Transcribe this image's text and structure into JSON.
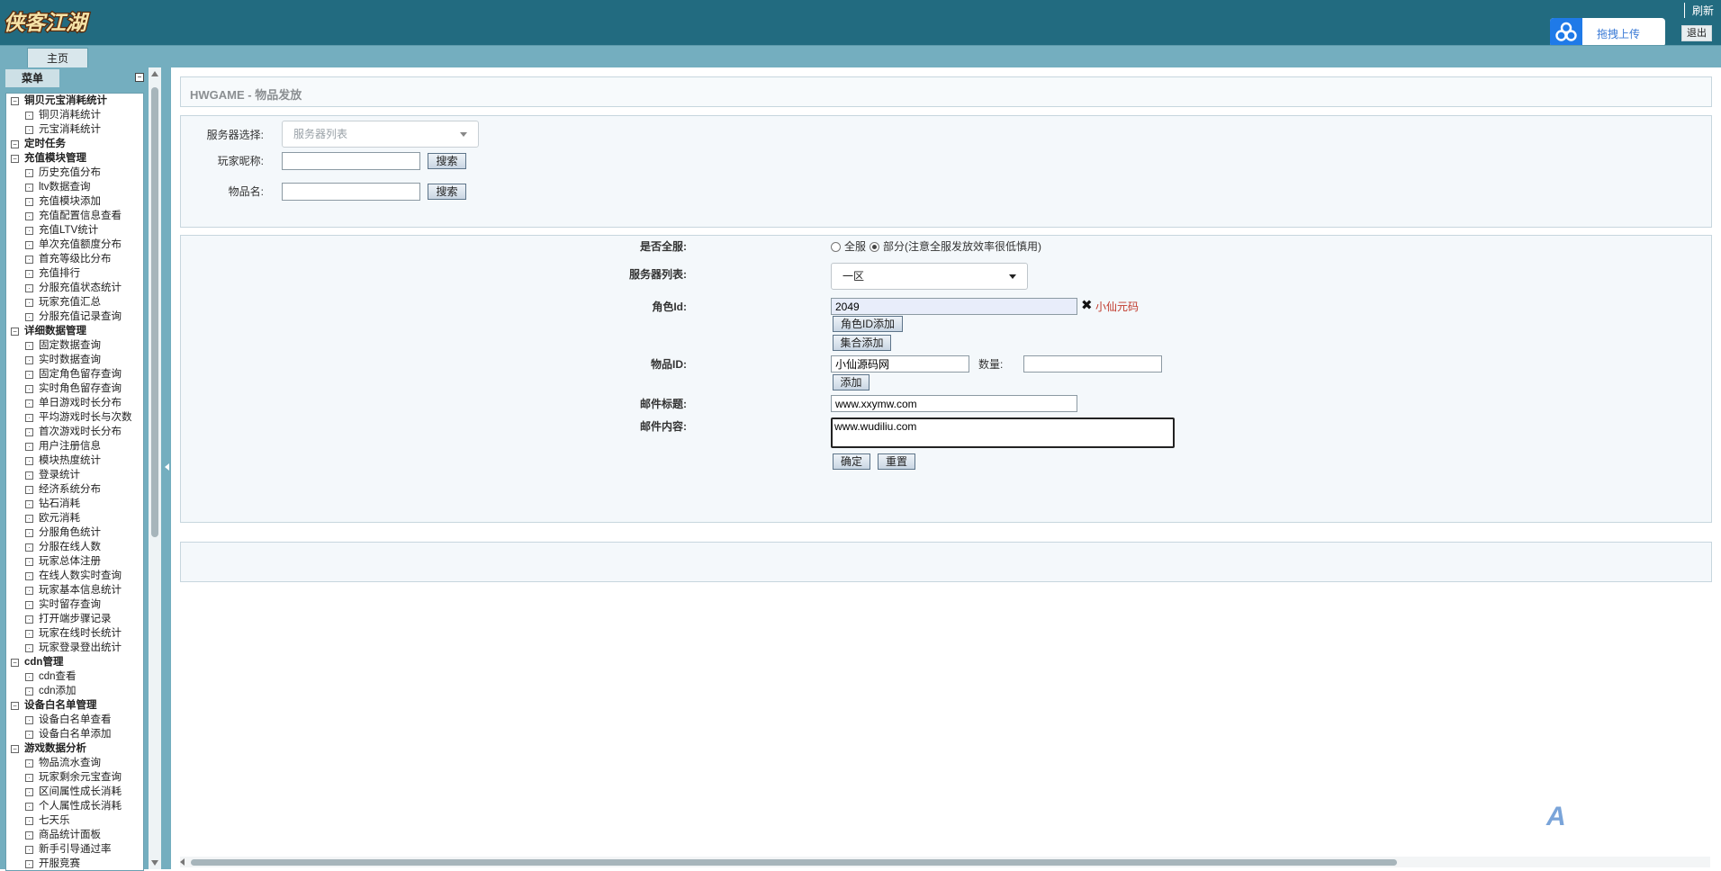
{
  "header": {
    "logo_text": "侠客江湖",
    "refresh_label": "刷新",
    "upload_label": "拖拽上传",
    "logout_label": "退出"
  },
  "tabs": {
    "home_label": "主页"
  },
  "sidebar": {
    "menu_label": "菜单",
    "groups": [
      {
        "label": "铜贝元宝消耗统计",
        "items": [
          "铜贝消耗统计",
          "元宝消耗统计"
        ]
      },
      {
        "label": "定时任务",
        "items": []
      },
      {
        "label": "充值模块管理",
        "items": [
          "历史充值分布",
          "ltv数据查询",
          "充值模块添加",
          "充值配置信息查看",
          "充值LTV统计",
          "单次充值额度分布",
          "首充等级比分布",
          "充值排行",
          "分服充值状态统计",
          "玩家充值汇总",
          "分服充值记录查询"
        ]
      },
      {
        "label": "详细数据管理",
        "items": [
          "固定数据查询",
          "实时数据查询",
          "固定角色留存查询",
          "实时角色留存查询",
          "单日游戏时长分布",
          "平均游戏时长与次数",
          "首次游戏时长分布",
          "用户注册信息",
          "模块热度统计",
          "登录统计",
          "经济系统分布",
          "钻石消耗",
          "欧元消耗",
          "分服角色统计",
          "分服在线人数",
          "玩家总体注册",
          "在线人数实时查询",
          "玩家基本信息统计",
          "实时留存查询",
          "打开端步骤记录",
          "玩家在线时长统计",
          "玩家登录登出统计"
        ]
      },
      {
        "label": "cdn管理",
        "items": [
          "cdn查看",
          "cdn添加"
        ]
      },
      {
        "label": "设备白名单管理",
        "items": [
          "设备白名单查看",
          "设备白名单添加"
        ]
      },
      {
        "label": "游戏数据分析",
        "items": [
          "物品流水查询",
          "玩家剩余元宝查询",
          "区间属性成长消耗",
          "个人属性成长消耗",
          "七天乐",
          "商品统计面板",
          "新手引导通过率",
          "开服竞赛"
        ]
      }
    ]
  },
  "page": {
    "title": "HWGAME - 物品发放"
  },
  "search_panel": {
    "server_label": "服务器选择:",
    "server_placeholder": "服务器列表",
    "player_label": "玩家昵称:",
    "player_value": "",
    "item_label": "物品名:",
    "item_value": "",
    "search_label": "搜索"
  },
  "send_form": {
    "all_server_label": "是否全服:",
    "option_all": "全服",
    "option_partial": "部分(注意全服发放效率很低慎用)",
    "selected_option": "partial",
    "server_list_label": "服务器列表:",
    "server_selected": "一区",
    "role_id_label": "角色Id:",
    "role_id_value": "2049",
    "role_clear_label": "小仙元码",
    "add_role_label": "角色ID添加",
    "batch_add_label": "集合添加",
    "item_id_label": "物品ID:",
    "item_id_value": "小仙源码网",
    "quantity_label": "数量:",
    "quantity_value": "",
    "add_label": "添加",
    "mail_title_label": "邮件标题:",
    "mail_title_value": "www.xxymw.com",
    "mail_content_label": "邮件内容:",
    "mail_content_value": "www.wudiliu.com",
    "confirm_label": "确定",
    "reset_label": "重置"
  },
  "colors": {
    "header_bg": "#226b80",
    "tab_bar_bg": "#74aebf",
    "panel_bg": "#f4f8fb",
    "clear_text": "#c0392b",
    "upload_accent": "#1f7ae8"
  },
  "icons": {
    "upload": "cloud-upload-icon",
    "clear": "close-icon",
    "collapse": "collapse-icon"
  }
}
